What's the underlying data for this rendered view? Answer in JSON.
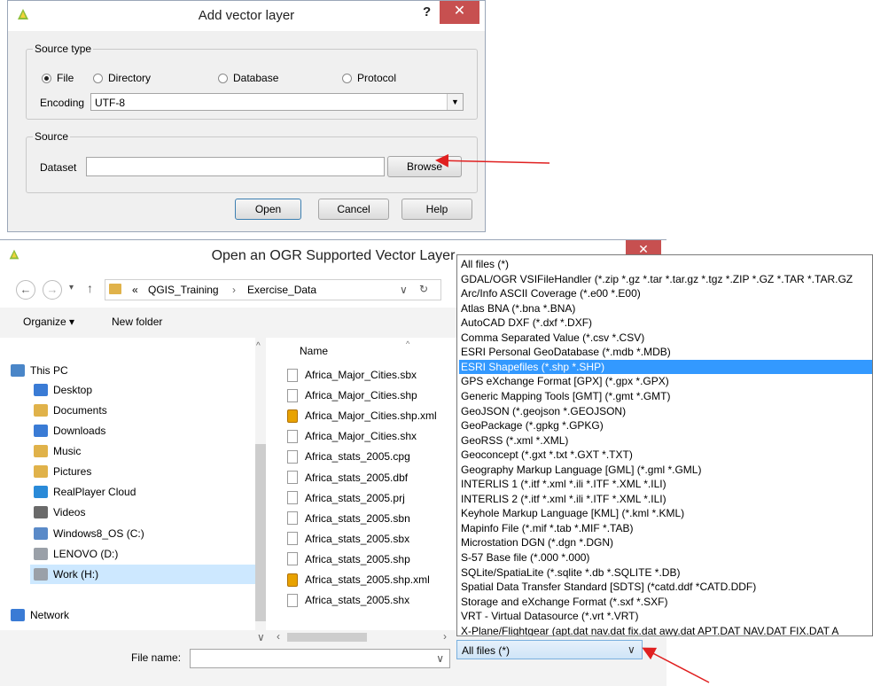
{
  "add_dialog": {
    "title": "Add vector layer",
    "help_glyph": "?",
    "close_glyph": "✕",
    "source_type_label": "Source type",
    "radios": [
      {
        "label": "File",
        "checked": true
      },
      {
        "label": "Directory",
        "checked": false
      },
      {
        "label": "Database",
        "checked": false
      },
      {
        "label": "Protocol",
        "checked": false
      }
    ],
    "encoding_label": "Encoding",
    "encoding_value": "UTF-8",
    "source_label": "Source",
    "dataset_label": "Dataset",
    "dataset_value": "",
    "browse_label": "Browse",
    "open_label": "Open",
    "cancel_label": "Cancel",
    "help_label": "Help"
  },
  "open_dialog": {
    "title": "Open an OGR Supported Vector Layer",
    "close_glyph": "✕",
    "nav": {
      "back": "←",
      "forward": "→",
      "recent": "▾",
      "up": "↑",
      "breadcrumb_prefix": "«",
      "crumbs": [
        "QGIS_Training",
        "Exercise_Data"
      ],
      "crumb_sep": "›",
      "dropdown": "∨",
      "refresh": "↻"
    },
    "toolbar": {
      "organize": "Organize ▾",
      "new_folder": "New folder"
    },
    "nav_pane": [
      {
        "label": "This PC",
        "icon": "computer-icon",
        "color": "#4a86c8"
      },
      {
        "label": "Desktop",
        "icon": "desktop-folder-icon",
        "color": "#3a7bd5"
      },
      {
        "label": "Documents",
        "icon": "documents-folder-icon",
        "color": "#e0b24a"
      },
      {
        "label": "Downloads",
        "icon": "downloads-folder-icon",
        "color": "#3a7bd5"
      },
      {
        "label": "Music",
        "icon": "music-folder-icon",
        "color": "#e0b24a"
      },
      {
        "label": "Pictures",
        "icon": "pictures-folder-icon",
        "color": "#e0b24a"
      },
      {
        "label": "RealPlayer Cloud",
        "icon": "realplayer-cloud-icon",
        "color": "#2a8ad8"
      },
      {
        "label": "Videos",
        "icon": "videos-folder-icon",
        "color": "#6a6a6a"
      },
      {
        "label": "Windows8_OS (C:)",
        "icon": "system-drive-icon",
        "color": "#5a8ac8"
      },
      {
        "label": "LENOVO (D:)",
        "icon": "drive-icon",
        "color": "#9aa0a8"
      },
      {
        "label": "Work (H:)",
        "icon": "drive-icon",
        "color": "#9aa0a8",
        "selected": true
      },
      {
        "label": "Network",
        "icon": "network-icon",
        "color": "#3a7bd5"
      }
    ],
    "name_header": "Name",
    "files": [
      {
        "name": "Africa_Major_Cities.sbx",
        "xml": false
      },
      {
        "name": "Africa_Major_Cities.shp",
        "xml": false
      },
      {
        "name": "Africa_Major_Cities.shp.xml",
        "xml": true
      },
      {
        "name": "Africa_Major_Cities.shx",
        "xml": false
      },
      {
        "name": "Africa_stats_2005.cpg",
        "xml": false
      },
      {
        "name": "Africa_stats_2005.dbf",
        "xml": false
      },
      {
        "name": "Africa_stats_2005.prj",
        "xml": false
      },
      {
        "name": "Africa_stats_2005.sbn",
        "xml": false
      },
      {
        "name": "Africa_stats_2005.sbx",
        "xml": false
      },
      {
        "name": "Africa_stats_2005.shp",
        "xml": false
      },
      {
        "name": "Africa_stats_2005.shp.xml",
        "xml": true
      },
      {
        "name": "Africa_stats_2005.shx",
        "xml": false
      }
    ],
    "file_name_label": "File name:",
    "file_name_value": "",
    "file_type_value": "All files (*)",
    "combo_arrow": "∨",
    "file_types": [
      "All files (*)",
      "GDAL/OGR VSIFileHandler (*.zip *.gz *.tar *.tar.gz *.tgz *.ZIP *.GZ *.TAR *.TAR.GZ",
      "Arc/Info ASCII Coverage (*.e00 *.E00)",
      "Atlas BNA (*.bna *.BNA)",
      "AutoCAD DXF (*.dxf *.DXF)",
      "Comma Separated Value (*.csv *.CSV)",
      "ESRI Personal GeoDatabase (*.mdb *.MDB)",
      "ESRI Shapefiles (*.shp *.SHP)",
      "GPS eXchange Format [GPX] (*.gpx *.GPX)",
      "Generic Mapping Tools [GMT] (*.gmt *.GMT)",
      "GeoJSON (*.geojson *.GEOJSON)",
      "GeoPackage (*.gpkg *.GPKG)",
      "GeoRSS (*.xml *.XML)",
      "Geoconcept (*.gxt *.txt *.GXT *.TXT)",
      "Geography Markup Language [GML] (*.gml *.GML)",
      "INTERLIS 1 (*.itf *.xml *.ili *.ITF *.XML *.ILI)",
      "INTERLIS 2 (*.itf *.xml *.ili *.ITF *.XML *.ILI)",
      "Keyhole Markup Language [KML] (*.kml *.KML)",
      "Mapinfo File (*.mif *.tab *.MIF *.TAB)",
      "Microstation DGN (*.dgn *.DGN)",
      "S-57 Base file (*.000 *.000)",
      "SQLite/SpatiaLite (*.sqlite *.db *.SQLITE *.DB)",
      "Spatial Data Transfer Standard [SDTS] (*catd.ddf *CATD.DDF)",
      "Storage and eXchange Format (*.sxf *.SXF)",
      "VRT - Virtual Datasource (*.vrt *.VRT)",
      "X-Plane/Flightgear (apt.dat nav.dat fix.dat awy.dat APT.DAT NAV.DAT FIX.DAT A"
    ],
    "selected_type_index": 7
  },
  "colors": {
    "annotation_arrow": "#e02020",
    "selection": "#3399ff",
    "close_button": "#c75050"
  }
}
